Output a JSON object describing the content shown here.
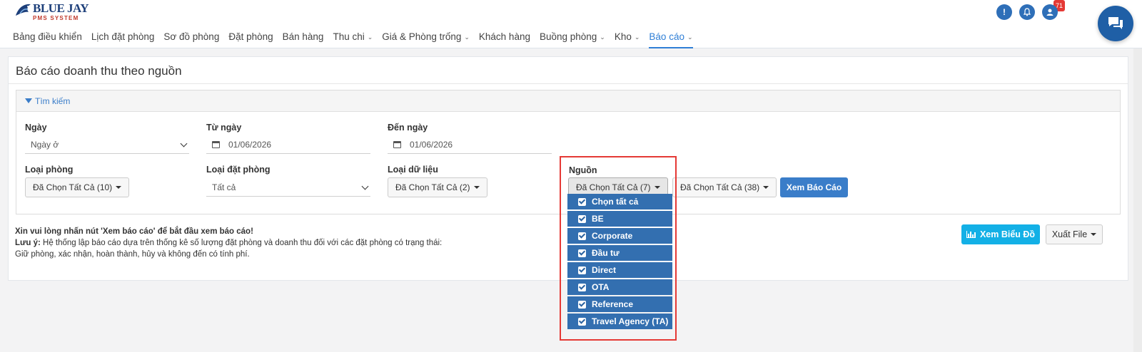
{
  "brand": {
    "name": "BLUE JAY",
    "subtitle": "PMS SYSTEM"
  },
  "nav": [
    {
      "label": "Bảng điều khiển",
      "dropdown": false,
      "active": false
    },
    {
      "label": "Lịch đặt phòng",
      "dropdown": false,
      "active": false
    },
    {
      "label": "Sơ đồ phòng",
      "dropdown": false,
      "active": false
    },
    {
      "label": "Đặt phòng",
      "dropdown": false,
      "active": false
    },
    {
      "label": "Bán hàng",
      "dropdown": false,
      "active": false
    },
    {
      "label": "Thu chi",
      "dropdown": true,
      "active": false
    },
    {
      "label": "Giá & Phòng trống",
      "dropdown": true,
      "active": false
    },
    {
      "label": "Khách hàng",
      "dropdown": false,
      "active": false
    },
    {
      "label": "Buồng phòng",
      "dropdown": true,
      "active": false
    },
    {
      "label": "Kho",
      "dropdown": true,
      "active": false
    },
    {
      "label": "Báo cáo",
      "dropdown": true,
      "active": true
    }
  ],
  "header": {
    "notification_count": "71",
    "warning_glyph": "!",
    "chevron_glyph": "⌄"
  },
  "page": {
    "title": "Báo cáo doanh thu theo nguồn"
  },
  "search": {
    "title": "Tìm kiếm",
    "date_type": {
      "label": "Ngày",
      "value": "Ngày ở"
    },
    "from_date": {
      "label": "Từ ngày",
      "value": "01/06/2026"
    },
    "to_date": {
      "label": "Đến ngày",
      "value": "01/06/2026"
    },
    "room_type": {
      "label": "Loại phòng",
      "value": "Đã Chọn Tất Cả (10)"
    },
    "booking_type": {
      "label": "Loại đặt phòng",
      "value": "Tất cả"
    },
    "data_type": {
      "label": "Loại dữ liệu",
      "value": "Đã Chọn Tất Cả (2)"
    },
    "source": {
      "label": "Nguồn",
      "value": "Đã Chọn Tất Cả (7)",
      "options": [
        "Chọn tất cả",
        "BE",
        "Corporate",
        "Đầu tư",
        "Direct",
        "OTA",
        "Reference",
        "Travel Agency (TA)"
      ]
    },
    "extra_filter": {
      "value": "Đã Chọn Tất Cả (38)"
    },
    "view_button": "Xem Báo Cáo"
  },
  "note": {
    "line1": "Xin vui lòng nhấn nút 'Xem báo cáo' để bắt đầu xem báo cáo!",
    "label": "Lưu ý:",
    "line2": " Hệ thống lập báo cáo dựa trên thống kê số lượng đặt phòng và doanh thu đối với các đặt phòng có trạng thái:",
    "line3": "Giữ phòng, xác nhận, hoàn thành, hủy và không đến có tính phí."
  },
  "actions": {
    "chart_button": "Xem Biểu Đồ",
    "export_button": "Xuất File"
  },
  "colors": {
    "primary": "#3a7dc9",
    "selected_item": "#336fb0",
    "highlight": "#e53935",
    "chart_button": "#13b0e6",
    "brand_blue": "#1d3f7a"
  },
  "icons": [
    "bird-logo-icon",
    "warning-icon",
    "bell-icon",
    "user-icon",
    "chat-icon",
    "filter-icon",
    "calendar-icon",
    "bar-chart-icon",
    "checkbox-icon"
  ]
}
